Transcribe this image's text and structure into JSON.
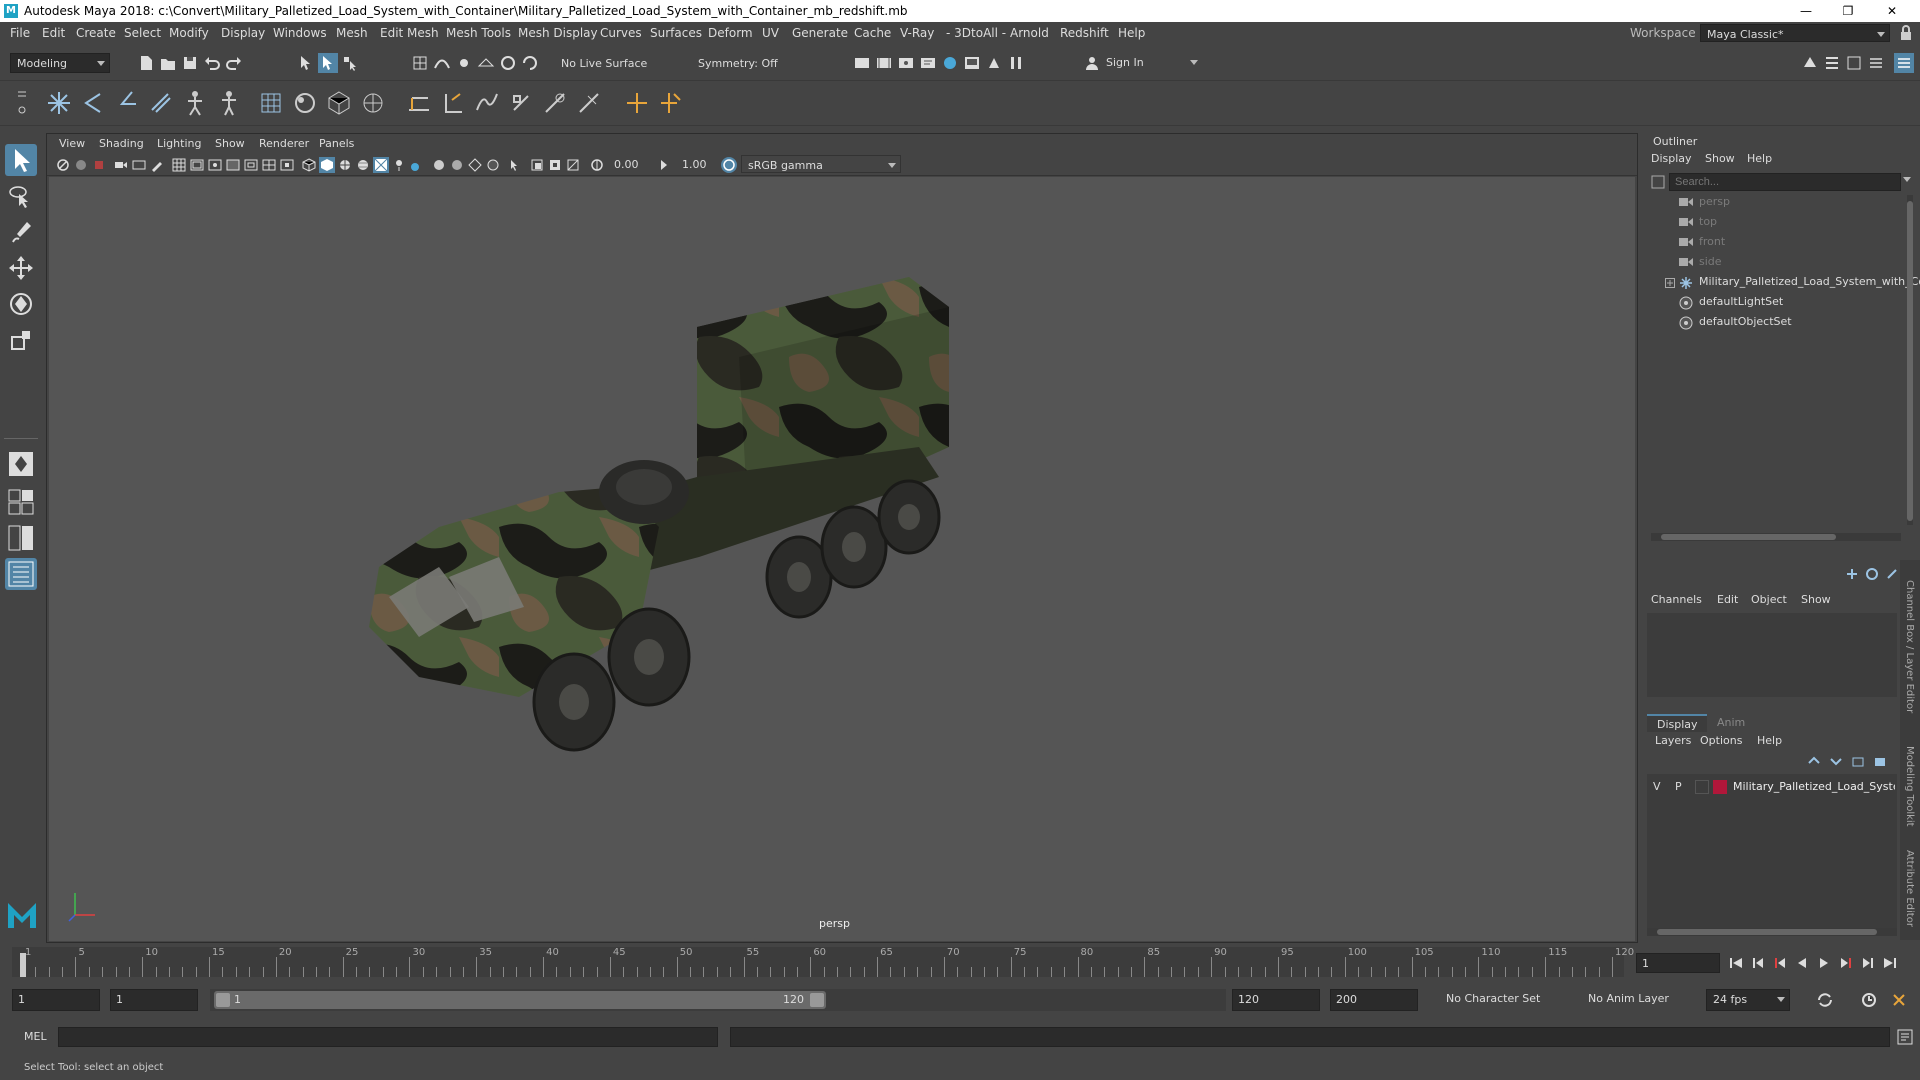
{
  "title_bar": {
    "text": "Autodesk Maya 2018: c:\\Convert\\Military_Palletized_Load_System_with_Container\\Military_Palletized_Load_System_with_Container_mb_redshift.mb",
    "minimize": "—",
    "maximize": "❐",
    "close": "✕"
  },
  "menubar": {
    "items": [
      "File",
      "Edit",
      "Create",
      "Select",
      "Modify",
      "Display",
      "Windows",
      "Mesh",
      "Edit Mesh",
      "Mesh Tools",
      "Mesh Display",
      "Curves",
      "Surfaces",
      "Deform",
      "UV",
      "Generate",
      "Cache",
      "V-Ray",
      "- 3DtoAll -",
      "Arnold",
      "Redshift",
      "Help"
    ],
    "workspace_label": "Workspace :",
    "workspace_value": "Maya Classic*"
  },
  "status_line": {
    "mode": "Modeling",
    "live_surface": "No Live Surface",
    "symmetry": "Symmetry: Off",
    "sign_in": "Sign In"
  },
  "panel": {
    "menus": [
      "View",
      "Shading",
      "Lighting",
      "Show",
      "Renderer",
      "Panels"
    ],
    "exposure": "0.00",
    "gamma": "1.00",
    "color_space": "sRGB gamma",
    "camera_label": "persp"
  },
  "outliner": {
    "title": "Outliner",
    "menus": [
      "Display",
      "Show",
      "Help"
    ],
    "search_placeholder": "Search...",
    "items": [
      {
        "label": "persp",
        "type": "camera",
        "dim": true
      },
      {
        "label": "top",
        "type": "camera",
        "dim": true
      },
      {
        "label": "front",
        "type": "camera",
        "dim": true
      },
      {
        "label": "side",
        "type": "camera",
        "dim": true
      },
      {
        "label": "Military_Palletized_Load_System_with_Co",
        "type": "group",
        "dim": false
      },
      {
        "label": "defaultLightSet",
        "type": "set",
        "dim": false
      },
      {
        "label": "defaultObjectSet",
        "type": "set",
        "dim": false
      }
    ]
  },
  "channel_box": {
    "menus": [
      "Channels",
      "Edit",
      "Object",
      "Show"
    ]
  },
  "layer_editor": {
    "tabs": [
      "Display",
      "Anim"
    ],
    "menus": [
      "Layers",
      "Options",
      "Help"
    ],
    "layer": {
      "v": "V",
      "p": "P",
      "name": "Military_Palletized_Load_System",
      "color": "#b0173a"
    }
  },
  "side_tabs": [
    "Channel Box / Layer Editor",
    "Modeling Toolkit",
    "Attribute Editor"
  ],
  "time_slider": {
    "ticks": [
      "1",
      "5",
      "10",
      "15",
      "20",
      "25",
      "30",
      "35",
      "40",
      "45",
      "50",
      "55",
      "60",
      "65",
      "70",
      "75",
      "80",
      "85",
      "90",
      "95",
      "100",
      "105",
      "110",
      "115",
      "120"
    ],
    "current_frame": "1"
  },
  "range_slider": {
    "start_time": "1",
    "playback_start": "1",
    "range_start": "1",
    "range_end": "120",
    "playback_end": "120",
    "end_time": "200",
    "character_set": "No Character Set",
    "anim_layer": "No Anim Layer",
    "fps": "24 fps"
  },
  "command_line": {
    "label": "MEL"
  },
  "help_line": {
    "text": "Select Tool: select an object"
  },
  "colors": {
    "accent": "#5285a6",
    "panel_bg": "#444444",
    "viewport_bg": "#555555",
    "field_bg": "#2b2b2b"
  }
}
